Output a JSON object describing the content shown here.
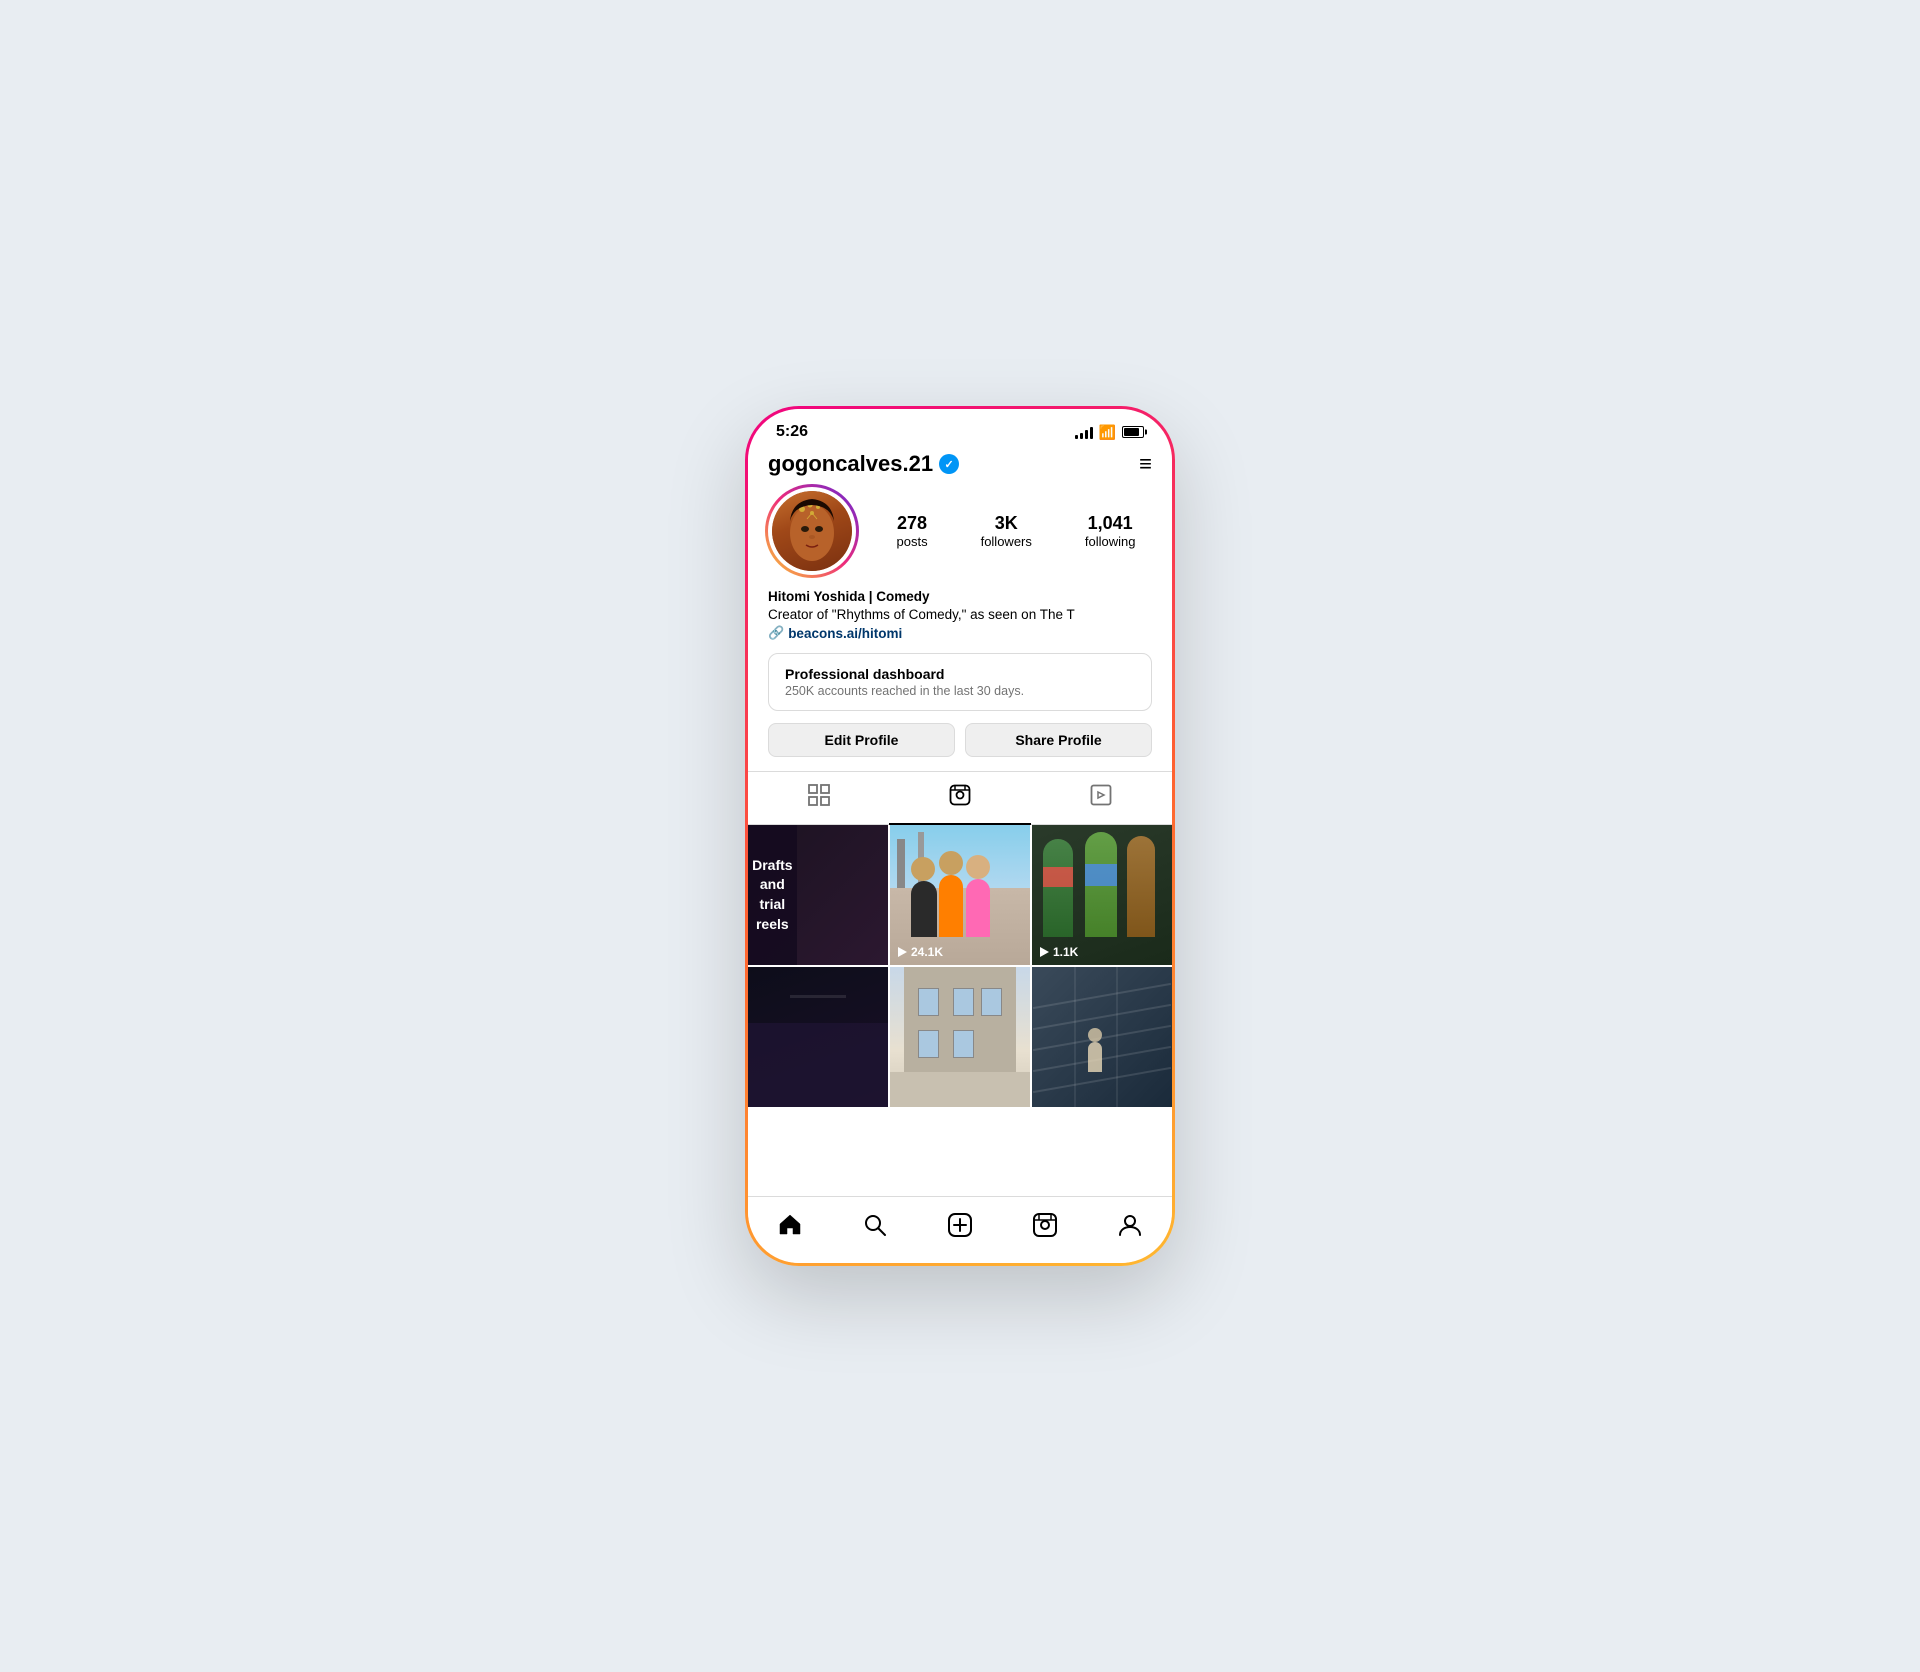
{
  "status": {
    "time": "5:26"
  },
  "header": {
    "username": "gogoncalves.21",
    "menu_icon": "≡"
  },
  "profile": {
    "stats": [
      {
        "value": "278",
        "label": "posts"
      },
      {
        "value": "3K",
        "label": "followers"
      },
      {
        "value": "1,041",
        "label": "following"
      }
    ],
    "bio_name": "Hitomi Yoshida | Comedy",
    "bio_text": "Creator of \"Rhythms of Comedy,\" as seen on The T",
    "bio_link": "beacons.ai/hitomi"
  },
  "dashboard": {
    "title": "Professional dashboard",
    "subtitle": "250K accounts reached in the last 30 days."
  },
  "buttons": {
    "edit_profile": "Edit Profile",
    "share_profile": "Share Profile"
  },
  "tabs": [
    {
      "id": "grid",
      "active": false
    },
    {
      "id": "reels",
      "active": true
    },
    {
      "id": "tagged",
      "active": false
    }
  ],
  "grid": {
    "drafts_label": "Drafts and\ntrial reels",
    "cells": [
      {
        "type": "drafts"
      },
      {
        "type": "street",
        "count": "24.1K"
      },
      {
        "type": "people",
        "count": "1.1K"
      },
      {
        "type": "dark"
      },
      {
        "type": "outdoor"
      },
      {
        "type": "stairs"
      }
    ]
  },
  "bottom_nav": {
    "items": [
      "home",
      "search",
      "create",
      "reels",
      "profile"
    ]
  }
}
